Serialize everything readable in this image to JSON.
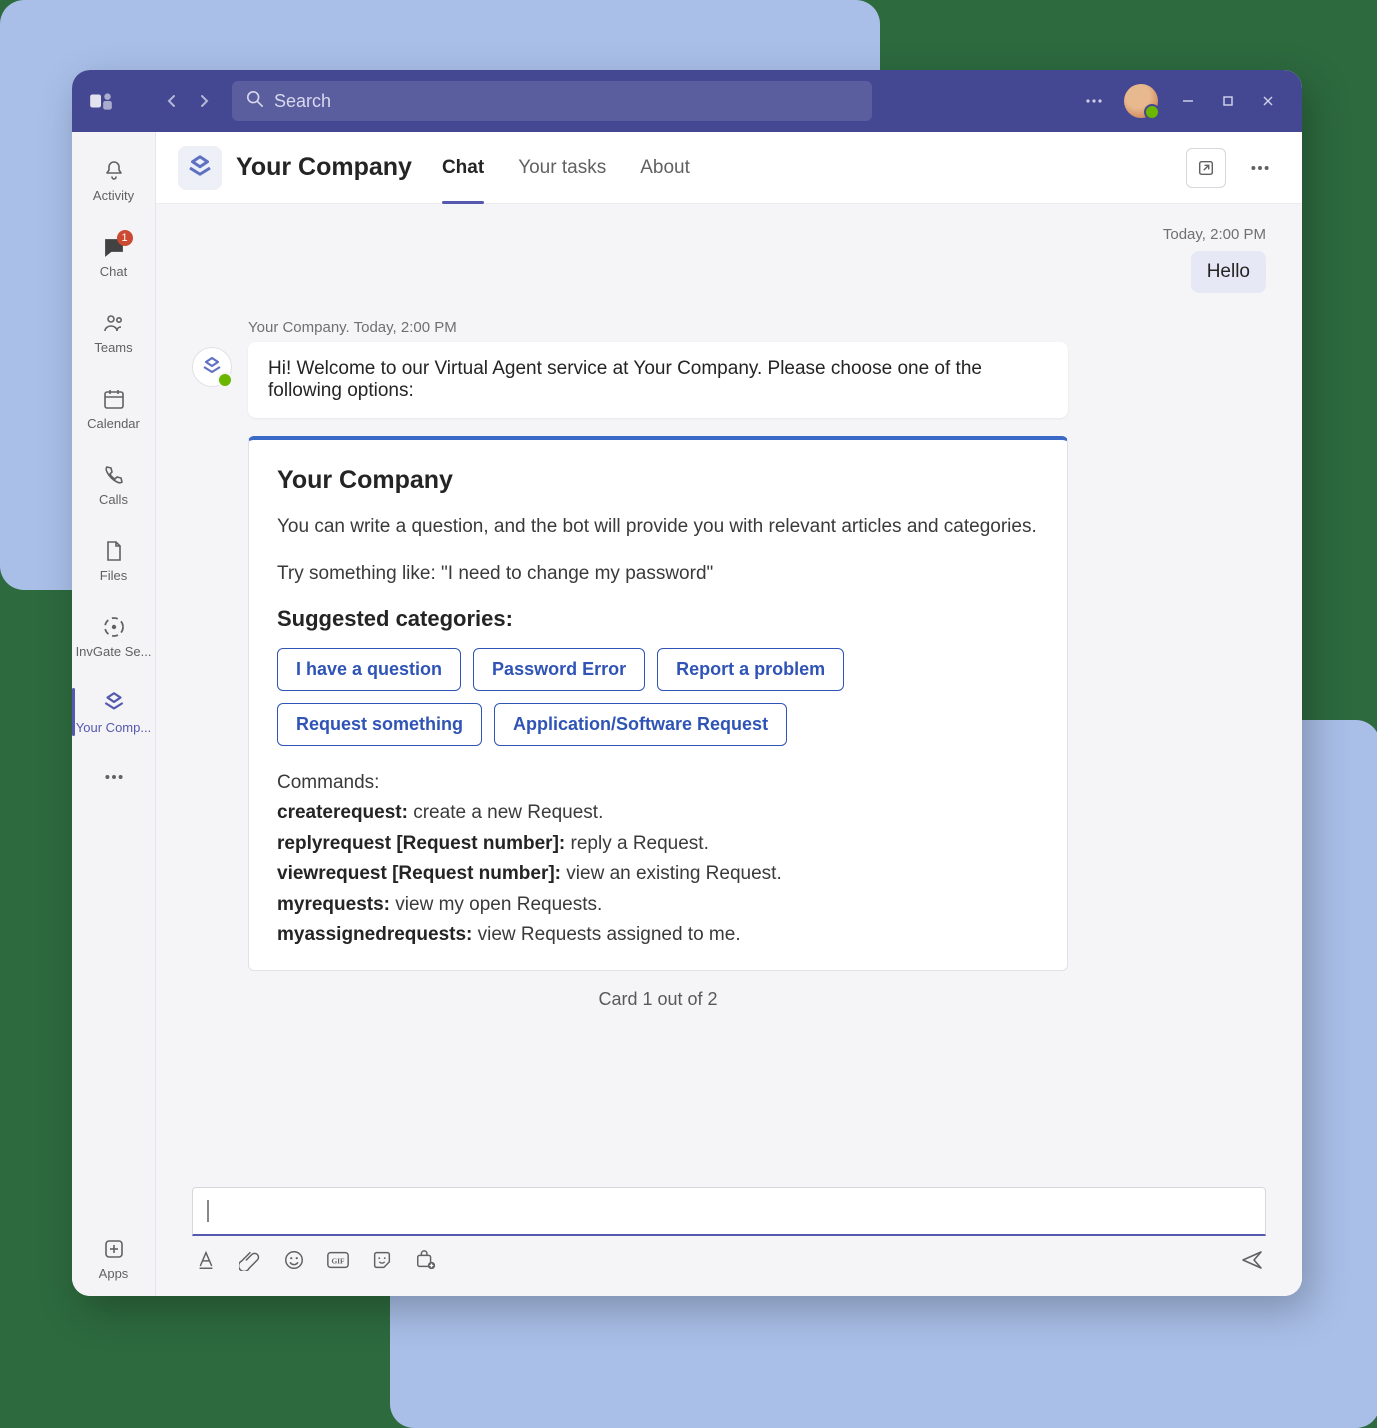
{
  "titlebar": {
    "search_placeholder": "Search"
  },
  "rail": [
    {
      "key": "activity",
      "label": "Activity"
    },
    {
      "key": "chat",
      "label": "Chat",
      "badge": "1"
    },
    {
      "key": "teams",
      "label": "Teams"
    },
    {
      "key": "calendar",
      "label": "Calendar"
    },
    {
      "key": "calls",
      "label": "Calls"
    },
    {
      "key": "files",
      "label": "Files"
    },
    {
      "key": "invgate",
      "label": "InvGate Se..."
    },
    {
      "key": "yourcompany",
      "label": "Your Comp..."
    }
  ],
  "rail_tail": {
    "apps_label": "Apps"
  },
  "header": {
    "app_title": "Your Company",
    "tabs": [
      "Chat",
      "Your tasks",
      "About"
    ]
  },
  "chat": {
    "day_time": "Today, 2:00 PM",
    "user_bubble": "Hello",
    "bot_meta": "Your Company. Today, 2:00 PM",
    "bot_text": "Hi! Welcome to our Virtual Agent service at Your Company. Please choose one of the following options:"
  },
  "card": {
    "title": "Your Company",
    "intro": "You can write a question, and the bot will provide you with relevant articles and categories.",
    "try_text": "Try something like: \"I need to change my password\"",
    "suggested_heading": "Suggested categories:",
    "chips": [
      "I have a question",
      "Password Error",
      "Report a problem",
      "Request something",
      "Application/Software Request"
    ],
    "commands_label": "Commands:",
    "commands": [
      {
        "name": "createrequest:",
        "desc": " create a new Request."
      },
      {
        "name": "replyrequest [Request number]:",
        "desc": " reply a Request."
      },
      {
        "name": "viewrequest [Request number]:",
        "desc": " view an existing Request."
      },
      {
        "name": "myrequests:",
        "desc": " view my open Requests."
      },
      {
        "name": "myassignedrequests:",
        "desc": " view Requests assigned to me."
      }
    ],
    "footer": "Card 1 out of 2"
  }
}
